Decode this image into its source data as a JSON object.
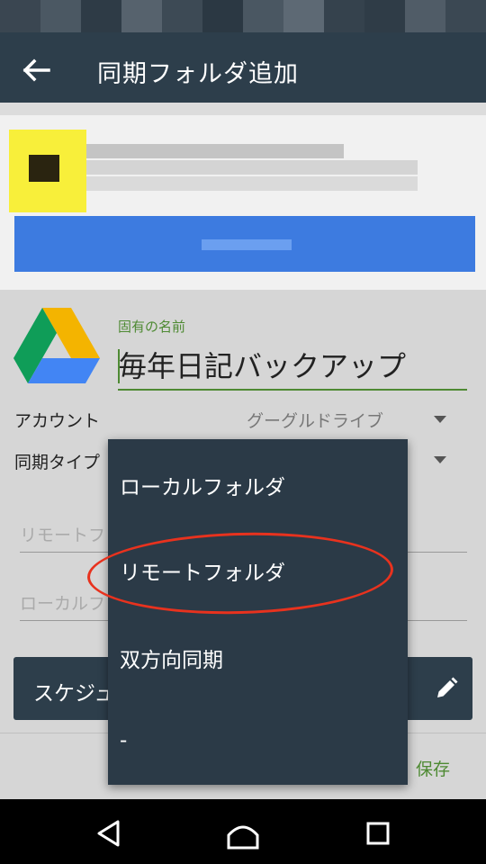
{
  "toolbar": {
    "title": "同期フォルダ追加",
    "back_icon": "arrow-back-icon"
  },
  "form": {
    "name_label": "固有の名前",
    "name_value": "毎年日記バックアップ",
    "account_label": "アカウント",
    "account_value": "グーグルドライブ",
    "sync_type_label": "同期タイプ",
    "remote_folder_placeholder": "リモートフ",
    "local_folder_placeholder": "ローカルフ",
    "schedule_label": "スケジュ",
    "save_label": "保存"
  },
  "dropdown": {
    "items": [
      "ローカルフォルダ",
      "リモートフォルダ",
      "双方向同期",
      "-"
    ],
    "highlighted": "リモートフォルダ",
    "highlight_color": "#e8321e"
  },
  "icons": {
    "drive": "google-drive-icon",
    "dropdown": "dropdown-arrow-icon",
    "schedule_edit": "pencil-icon",
    "nav": [
      "nav-back-icon",
      "nav-home-icon",
      "nav-recents-icon"
    ]
  },
  "colors": {
    "toolbar": "#2d3e4b",
    "accent_green": "#4e8a33",
    "banner_button": "#3d7be0"
  }
}
